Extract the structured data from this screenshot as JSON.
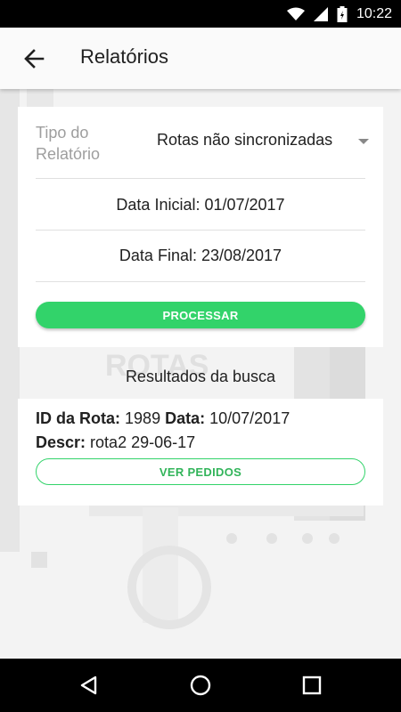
{
  "status_bar": {
    "time": "10:22",
    "icons": [
      "wifi-icon",
      "signal-icon",
      "battery-icon"
    ]
  },
  "app_bar": {
    "title": "Relatórios",
    "back_icon": "arrow-back-icon"
  },
  "background_watermark": "ROTAS",
  "form": {
    "tipo_label": "Tipo do Relatório",
    "tipo_value": "Rotas não sincronizadas",
    "data_inicial": "Data Inicial: 01/07/2017",
    "data_final": "Data Final: 23/08/2017",
    "processar_label": "PROCESSAR"
  },
  "results": {
    "title": "Resultados da busca",
    "items": [
      {
        "id_label": "ID da Rota:",
        "id_value": "1989",
        "data_label": "Data:",
        "data_value": "10/07/2017",
        "descr_label": "Descr:",
        "descr_value": "rota2 29-06-17",
        "action_label": "VER PEDIDOS"
      }
    ]
  },
  "colors": {
    "accent": "#32d36a",
    "accent_text": "#32b45a",
    "background": "#f2f2f2"
  },
  "nav_bar": {
    "icons": [
      "back-triangle-icon",
      "home-circle-icon",
      "recents-square-icon"
    ]
  }
}
